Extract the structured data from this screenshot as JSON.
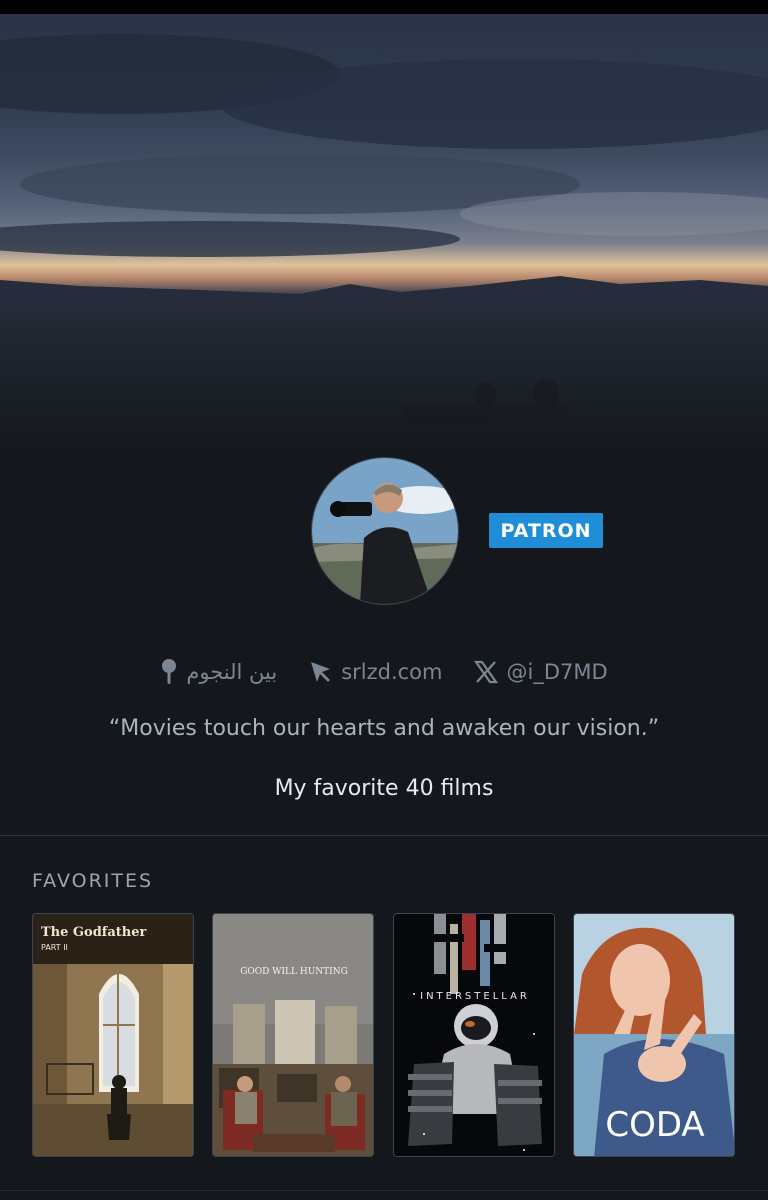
{
  "profile": {
    "badge": "PATRON",
    "location": "بين النجوم",
    "website": "srlzd.com",
    "twitter": "@i_D7MD",
    "bio": "“Movies touch our hearts and awaken our vision.”",
    "subline": "My favorite 40 films"
  },
  "favorites": {
    "title": "FAVORITES",
    "films": [
      {
        "poster_text": "The Godfather",
        "poster_subtext": "PART II"
      },
      {
        "poster_text": "GOOD WILL HUNTING"
      },
      {
        "poster_text": "INTERSTELLAR"
      },
      {
        "poster_text": "CODA"
      }
    ]
  },
  "icons": {
    "location": "map-pin-icon",
    "website": "cursor-arrow-icon",
    "twitter": "x-logo-icon"
  },
  "colors": {
    "background": "#14181c",
    "badge": "#1f8ed6",
    "meta_text": "#7b8694",
    "bio_text": "#a9b4c0"
  }
}
